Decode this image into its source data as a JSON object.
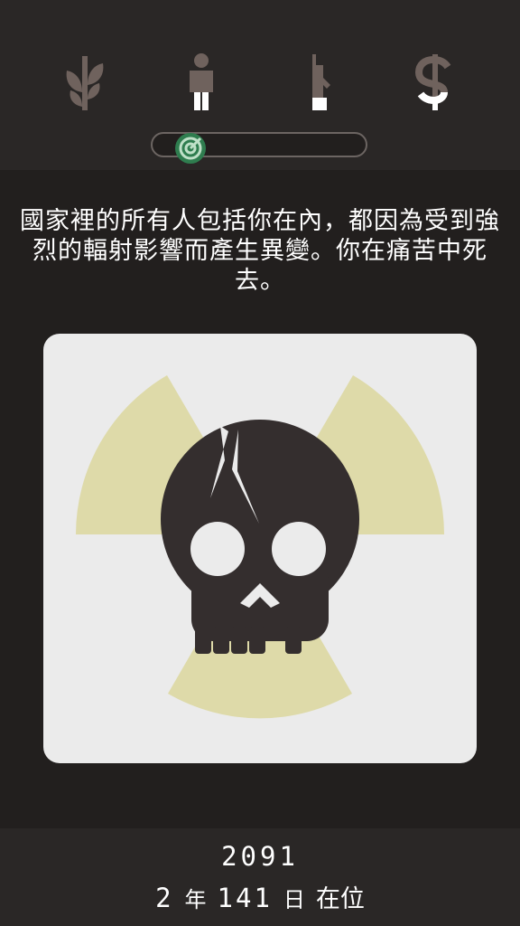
{
  "stats": [
    {
      "icon": "plant-icon",
      "name": "religion",
      "color": "#6f625d"
    },
    {
      "icon": "person-icon",
      "name": "people",
      "color": "#6f625d"
    },
    {
      "icon": "rifle-icon",
      "name": "military",
      "color": "#6f625d"
    },
    {
      "icon": "dollar-icon",
      "name": "money",
      "color": "#6f625d"
    }
  ],
  "progress": {
    "fraction": 0.1,
    "icon": "target-icon",
    "accent": "#2f7d4f"
  },
  "message": "國家裡的所有人包括你在內，都因為受到強烈的輻射影響而產生異變。你在痛苦中死去。",
  "card": {
    "background": "#ebebeb",
    "radiation_color": "#dedaa9",
    "skull_color": "#342e2e",
    "illustration": [
      "radiation-symbol",
      "cracked-skull"
    ]
  },
  "footer": {
    "year": "2091",
    "years_value": "2",
    "years_unit": "年",
    "days_value": "141",
    "days_unit": "日",
    "status": "在位"
  }
}
